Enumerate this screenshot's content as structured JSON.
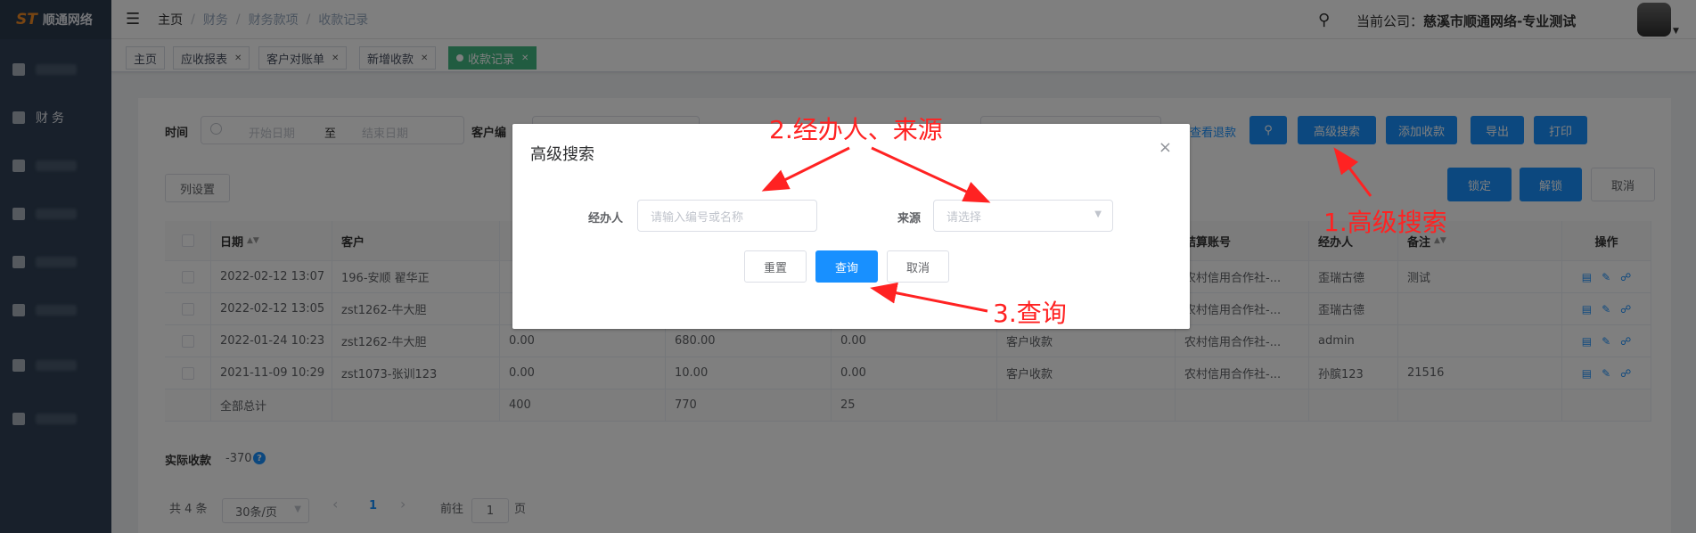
{
  "app": {
    "logo_mark": "ST",
    "logo_text": "顺通网络"
  },
  "sidebar": {
    "items": [
      {
        "label": ""
      },
      {
        "label": "财务"
      },
      {
        "label": ""
      },
      {
        "label": ""
      },
      {
        "label": ""
      },
      {
        "label": ""
      },
      {
        "label": ""
      },
      {
        "label": ""
      }
    ]
  },
  "header": {
    "breadcrumb": [
      "主页",
      "财务",
      "财务款项",
      "收款记录"
    ],
    "company_prefix": "当前公司：",
    "company_name": "慈溪市顺通网络-专业测试"
  },
  "tabs": [
    {
      "label": "主页",
      "closable": false
    },
    {
      "label": "应收报表",
      "closable": true
    },
    {
      "label": "客户对账单",
      "closable": true
    },
    {
      "label": "新增收款",
      "closable": true
    },
    {
      "label": "收款记录",
      "closable": true,
      "active": true
    }
  ],
  "filters": {
    "time_label": "时间",
    "start_placeholder": "开始日期",
    "range_separator": "至",
    "end_placeholder": "结束日期",
    "customer_label": "客户编",
    "refund_link": "查看退款"
  },
  "toolbar": {
    "search_icon": "search-icon",
    "advanced_search": "高级搜索",
    "add_receipt": "添加收款",
    "export": "导出",
    "print": "打印",
    "column_settings": "列设置",
    "lock": "锁定",
    "unlock": "解锁",
    "cancel": "取消"
  },
  "table": {
    "headers": [
      "日期",
      "客户",
      "",
      "",
      "",
      "",
      "结算账号",
      "经办人",
      "备注",
      "操作"
    ],
    "rows": [
      {
        "date": "2022-02-12 13:07",
        "customer": "196-安顺 翟华正",
        "c3": "",
        "c4": "",
        "c5": "",
        "c6": "",
        "account": "农村信用合作社-...",
        "handler": "歪瑞古德",
        "note": "测试"
      },
      {
        "date": "2022-02-12 13:05",
        "customer": "zst1262-牛大胆",
        "c3": "",
        "c4": "",
        "c5": "",
        "c6": "",
        "account": "农村信用合作社-...",
        "handler": "歪瑞古德",
        "note": ""
      },
      {
        "date": "2022-01-24 10:23",
        "customer": "zst1262-牛大胆",
        "c3": "0.00",
        "c4": "680.00",
        "c5": "0.00",
        "c6": "客户收款",
        "account": "农村信用合作社-...",
        "handler": "admin",
        "note": ""
      },
      {
        "date": "2021-11-09 10:29",
        "customer": "zst1073-张训123",
        "c3": "0.00",
        "c4": "10.00",
        "c5": "0.00",
        "c6": "客户收款",
        "account": "农村信用合作社-...",
        "handler": "孙膑123",
        "note": "21516"
      }
    ],
    "total": {
      "label": "全部总计",
      "c3": "400",
      "c4": "770",
      "c5": "25"
    }
  },
  "summary": {
    "label": "实际收款",
    "value": "-370",
    "help": "?"
  },
  "pagination": {
    "total_text": "共 4 条",
    "page_size": "30条/页",
    "prev": "‹",
    "current_page": "1",
    "next": "›",
    "goto_label": "前往",
    "goto_value": "1",
    "page_unit": "页"
  },
  "dialog": {
    "title": "高级搜索",
    "close": "×",
    "handler_label": "经办人",
    "handler_placeholder": "请输入编号或名称",
    "source_label": "来源",
    "source_placeholder": "请选择",
    "reset": "重置",
    "query": "查询",
    "cancel": "取消"
  },
  "annotations": {
    "step1": "1.高级搜索",
    "step2": "2.经办人、来源",
    "step3": "3.查询",
    "color": "#ff2222"
  }
}
